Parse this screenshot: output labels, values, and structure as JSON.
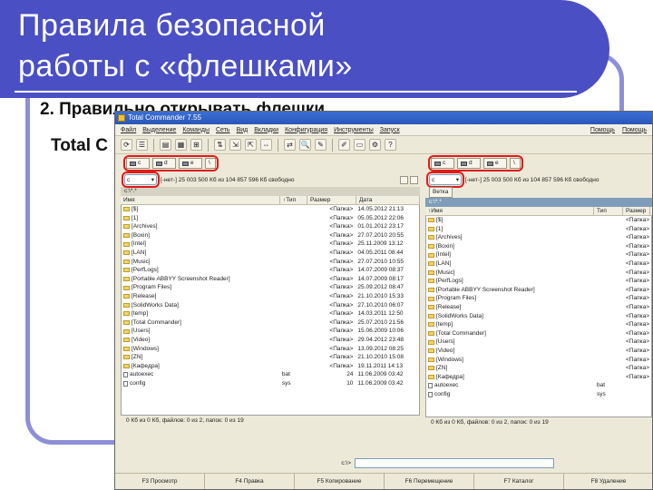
{
  "slide": {
    "title_line1": "Правила безопасной",
    "title_line2": "работы с «флешками»",
    "subtitle": "2. Правильно открывать флешки",
    "subtitle2": "Total C"
  },
  "colors": {
    "title_bg": "#4b4fc4",
    "frame": "#8d8fd8",
    "highlight": "#e11a1a",
    "window_bg": "#ece9d8"
  },
  "window": {
    "title": "Total Commander 7.55",
    "menu": [
      "Файл",
      "Выделение",
      "Команды",
      "Сеть",
      "Вид",
      "Вкладки",
      "Конфигурация",
      "Инструменты",
      "Запуск"
    ],
    "menu_right": [
      "Помощь",
      "Помощь"
    ]
  },
  "toolbar": {
    "buttons": [
      "refresh-icon",
      "list-icon",
      "details-icon",
      "thumbnails-icon",
      "tree-icon",
      "sort-icon",
      "unpack-icon",
      "pack-icon",
      "compare-icon",
      "sync-icon",
      "search-icon",
      "rename-icon",
      "notepad-icon",
      "terminal-icon",
      "settings-icon",
      "help-icon"
    ]
  },
  "left_panel": {
    "drives": [
      "c",
      "d",
      "e",
      "\\"
    ],
    "drive_select": "c",
    "free_space": "[-нет-]  25 003 500 Кб из 104 857 596 Кб свободно",
    "path": "c:\\*.*",
    "columns": {
      "name": "Имя",
      "ext": "↑Тип",
      "size": "Размер",
      "date": "Дата"
    },
    "rows": [
      {
        "name": "[$]",
        "ext": "",
        "size": "<Папка>",
        "date": "14.05.2012 21:13",
        "type": "folder"
      },
      {
        "name": "[1]",
        "ext": "",
        "size": "<Папка>",
        "date": "05.05.2012 22:06",
        "type": "folder"
      },
      {
        "name": "[Archives]",
        "ext": "",
        "size": "<Папка>",
        "date": "01.01.2012 23:17",
        "type": "folder"
      },
      {
        "name": "[Boxin]",
        "ext": "",
        "size": "<Папка>",
        "date": "27.07.2010 20:55",
        "type": "folder"
      },
      {
        "name": "[Intel]",
        "ext": "",
        "size": "<Папка>",
        "date": "25.11.2009 13:12",
        "type": "folder"
      },
      {
        "name": "[LAN]",
        "ext": "",
        "size": "<Папка>",
        "date": "04.05.2011 08:44",
        "type": "folder"
      },
      {
        "name": "[Music]",
        "ext": "",
        "size": "<Папка>",
        "date": "27.07.2010 10:55",
        "type": "folder"
      },
      {
        "name": "[PerfLogs]",
        "ext": "",
        "size": "<Папка>",
        "date": "14.07.2009 08:37",
        "type": "folder"
      },
      {
        "name": "[Portable ABBYY Screenshot Reader]",
        "ext": "",
        "size": "<Папка>",
        "date": "14.07.2009 08:17",
        "type": "folder"
      },
      {
        "name": "[Program Files]",
        "ext": "",
        "size": "<Папка>",
        "date": "25.09.2012 08:47",
        "type": "folder"
      },
      {
        "name": "[Release]",
        "ext": "",
        "size": "<Папка>",
        "date": "21.10.2010 15:33",
        "type": "folder"
      },
      {
        "name": "[SolidWorks Data]",
        "ext": "",
        "size": "<Папка>",
        "date": "27.10.2010 06:07",
        "type": "folder"
      },
      {
        "name": "[temp]",
        "ext": "",
        "size": "<Папка>",
        "date": "14.03.2011 12:50",
        "type": "folder"
      },
      {
        "name": "[Total Commander]",
        "ext": "",
        "size": "<Папка>",
        "date": "25.07.2010 21:56",
        "type": "folder"
      },
      {
        "name": "[Users]",
        "ext": "",
        "size": "<Папка>",
        "date": "15.06.2009 10:06",
        "type": "folder"
      },
      {
        "name": "[Video]",
        "ext": "",
        "size": "<Папка>",
        "date": "29.04.2012 23:48",
        "type": "folder"
      },
      {
        "name": "[Windows]",
        "ext": "",
        "size": "<Папка>",
        "date": "13.09.2012 08:25",
        "type": "folder"
      },
      {
        "name": "[ZN]",
        "ext": "",
        "size": "<Папка>",
        "date": "21.10.2010 15:08",
        "type": "folder"
      },
      {
        "name": "[Кафедра]",
        "ext": "",
        "size": "<Папка>",
        "date": "19.11.2011 14:13",
        "type": "folder"
      },
      {
        "name": "autoexec",
        "ext": "bat",
        "size": "24",
        "date": "11.06.2009 03:42",
        "type": "file"
      },
      {
        "name": "config",
        "ext": "sys",
        "size": "10",
        "date": "11.06.2009 03:42",
        "type": "file"
      }
    ],
    "status": "0 Кб из 0 Кб, файлов: 0 из 2, папок: 0 из 19"
  },
  "right_panel": {
    "drives": [
      "c",
      "d",
      "e",
      "\\"
    ],
    "drive_select": "c",
    "free_space": "[-нет-]  25 003 500 Кб из 104 857 596 Кб свободно",
    "tab_label": "Ветка",
    "path": "c:\\*.*",
    "columns": {
      "name": "↑Имя",
      "ext": "Тип",
      "size": "Размер"
    },
    "rows": [
      {
        "name": "[$]",
        "ext": "",
        "size": "<Папка>",
        "type": "folder"
      },
      {
        "name": "[1]",
        "ext": "",
        "size": "<Папка>",
        "type": "folder"
      },
      {
        "name": "[Archives]",
        "ext": "",
        "size": "<Папка>",
        "type": "folder"
      },
      {
        "name": "[Boxin]",
        "ext": "",
        "size": "<Папка>",
        "type": "folder"
      },
      {
        "name": "[Intel]",
        "ext": "",
        "size": "<Папка>",
        "type": "folder"
      },
      {
        "name": "[LAN]",
        "ext": "",
        "size": "<Папка>",
        "type": "folder"
      },
      {
        "name": "[Music]",
        "ext": "",
        "size": "<Папка>",
        "type": "folder"
      },
      {
        "name": "[PerfLogs]",
        "ext": "",
        "size": "<Папка>",
        "type": "folder"
      },
      {
        "name": "[Portable ABBYY Screenshot Reader]",
        "ext": "",
        "size": "<Папка>",
        "type": "folder"
      },
      {
        "name": "[Program Files]",
        "ext": "",
        "size": "<Папка>",
        "type": "folder"
      },
      {
        "name": "[Release]",
        "ext": "",
        "size": "<Папка>",
        "type": "folder"
      },
      {
        "name": "[SolidWorks Data]",
        "ext": "",
        "size": "<Папка>",
        "type": "folder"
      },
      {
        "name": "[temp]",
        "ext": "",
        "size": "<Папка>",
        "type": "folder"
      },
      {
        "name": "[Total Commander]",
        "ext": "",
        "size": "<Папка>",
        "type": "folder"
      },
      {
        "name": "[Users]",
        "ext": "",
        "size": "<Папка>",
        "type": "folder"
      },
      {
        "name": "[Video]",
        "ext": "",
        "size": "<Папка>",
        "type": "folder"
      },
      {
        "name": "[Windows]",
        "ext": "",
        "size": "<Папка>",
        "type": "folder"
      },
      {
        "name": "[ZN]",
        "ext": "",
        "size": "<Папка>",
        "type": "folder"
      },
      {
        "name": "[Кафедра]",
        "ext": "",
        "size": "<Папка>",
        "type": "folder"
      },
      {
        "name": "autoexec",
        "ext": "bat",
        "size": "",
        "type": "file"
      },
      {
        "name": "config",
        "ext": "sys",
        "size": "",
        "type": "file"
      }
    ],
    "status": "0 Кб из 0 Кб, файлов: 0 из 2, папок: 0 из 19"
  },
  "command_line": {
    "label": "c:\\>",
    "value": ""
  },
  "fkeys": [
    "F3 Просмотр",
    "F4 Правка",
    "F5 Копирование",
    "F6 Перемещение",
    "F7 Каталог",
    "F8 Удаление"
  ]
}
